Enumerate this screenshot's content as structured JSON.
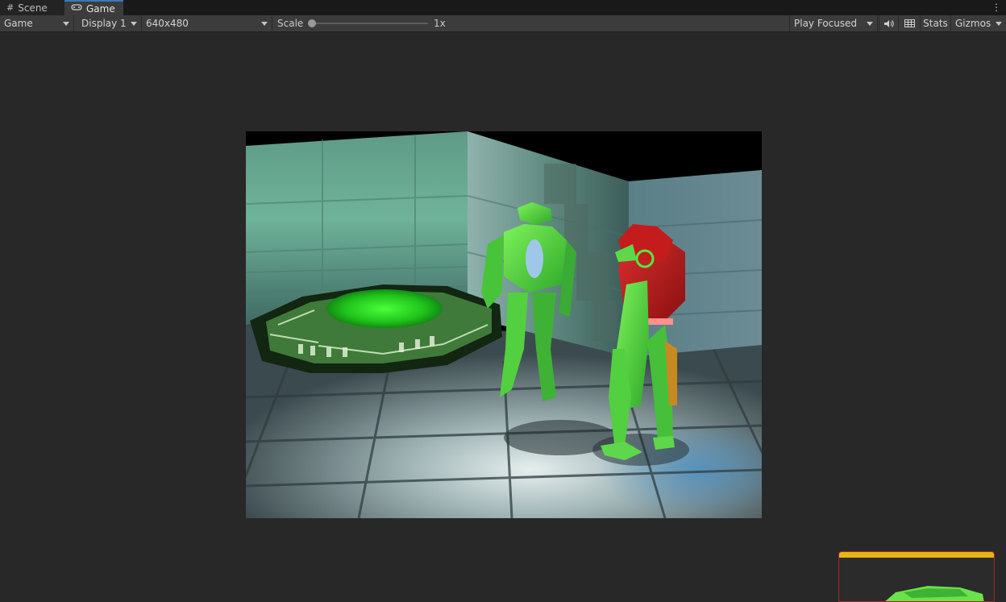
{
  "tabs": [
    {
      "label": "Scene",
      "icon": "grid-icon"
    },
    {
      "label": "Game",
      "icon": "gamepad-icon"
    }
  ],
  "toolbar": {
    "game_mode": "Game",
    "display": "Display 1",
    "resolution": "640x480",
    "scale_label": "Scale",
    "scale_value": "1x",
    "scale_fraction": 0.0,
    "play_mode": "Play Focused",
    "audio_icon": "speaker-icon",
    "stats_label": "Stats",
    "gizmos_label": "Gizmos"
  },
  "colors": {
    "accent_tab": "#3a79bb",
    "overlay_bar": "#e8b416"
  }
}
